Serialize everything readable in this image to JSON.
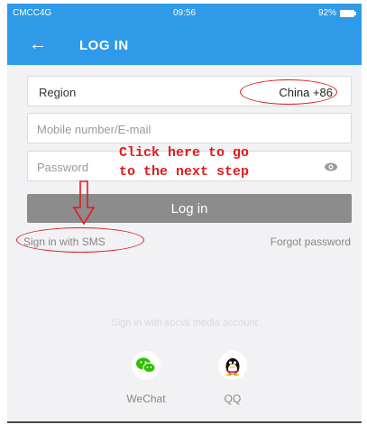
{
  "statusbar": {
    "carrier": "CMCC4G",
    "time": "09:56",
    "battery": "92%"
  },
  "appbar": {
    "back_icon": "back-arrow-icon",
    "title": "LOG IN"
  },
  "form": {
    "region_label": "Region",
    "region_value": "China +86",
    "mobile_placeholder": "Mobile number/E-mail",
    "password_placeholder": "Password",
    "eye_icon": "eye-icon",
    "login_label": "Log in"
  },
  "links": {
    "sms": "Sign in with SMS",
    "forgot": "Forgot password"
  },
  "annotation": {
    "line1": "Click here to go",
    "line2": "to the next step",
    "color": "#e01b1b"
  },
  "social": {
    "title": "Sign in with social media account",
    "items": [
      {
        "name": "WeChat",
        "icon": "wechat-icon",
        "color": "#2dc100"
      },
      {
        "name": "QQ",
        "icon": "qq-penguin-icon",
        "color": "#111111"
      }
    ]
  },
  "colors": {
    "primary": "#2e9ae8",
    "login_button": "#8c8c8c",
    "background": "#f2f2f4"
  }
}
